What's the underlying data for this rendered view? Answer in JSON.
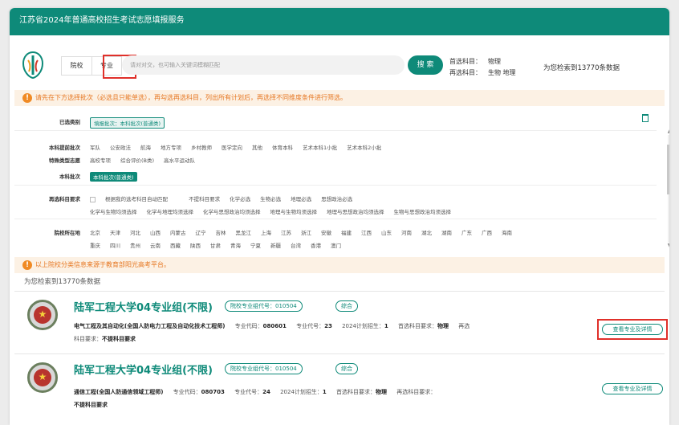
{
  "header": {
    "title": "江苏省2024年普通高校招生考试志愿填报服务"
  },
  "search": {
    "tab_school": "院校",
    "tab_major": "专业",
    "placeholder": "请对对交，也可输入关键词模糊匹配",
    "button": "搜 索",
    "first_subject_label": "首选科目：",
    "first_subject_value": "物理",
    "second_subject_label": "再选科目：",
    "second_subject_values": "生物 地理",
    "result_count": "为您检索到13770条数据"
  },
  "notice1": "请先在下方选择批次（必选且只能单选），再勾选再选科目，列出所有计划后，再选择不同维度条件进行筛选。",
  "notice2": "以上院校分类信息来源于教育部阳光高考平台。",
  "filters": {
    "selected_label": "已选类别",
    "selected_tag": "填报批次：本科批次(普通类)",
    "early_label": "本科提前批次",
    "early_options": [
      "军队",
      "公安政法",
      "航海",
      "地方专项",
      "乡村教师",
      "医学定向",
      "其他",
      "体育本科",
      "艺术本科1小批",
      "艺术本科2小批"
    ],
    "special_label": "特殊类型志愿",
    "special_options": [
      "高校专项",
      "综合评价(B类)",
      "高水平运动队"
    ],
    "batch_label": "本科批次",
    "batch_value": "本科批次(普通类)",
    "resubject_label": "再选科目要求",
    "resubject_check": "根据我的选考科目自动匹配",
    "resubject_row1": [
      "不提科目要求",
      "化学必选",
      "生物必选",
      "地理必选",
      "思想政治必选"
    ],
    "resubject_row2": [
      "化学与生物均须选择",
      "化学与地理均须选择",
      "化学与思想政治均须选择",
      "地理与生物均须选择",
      "地理与思想政治均须选择",
      "生物与思想政治均须选择"
    ],
    "region_label": "院校所在地",
    "region_row1": [
      "北京",
      "天津",
      "河北",
      "山西",
      "内蒙古",
      "辽宁",
      "吉林",
      "黑龙江",
      "上海",
      "江苏",
      "浙江",
      "安徽",
      "福建",
      "江西",
      "山东",
      "河南",
      "湖北",
      "湖南",
      "广东",
      "广西",
      "海南"
    ],
    "region_row2": [
      "重庆",
      "四川",
      "贵州",
      "云南",
      "西藏",
      "陕西",
      "甘肃",
      "青海",
      "宁夏",
      "新疆",
      "台湾",
      "香港",
      "澳门"
    ]
  },
  "results_count": "为您检索到13770条数据",
  "cards": [
    {
      "name": "陆军工程大学04专业组(不限)",
      "group_code": "院校专业组代号：010504",
      "tag": "综合",
      "major": "电气工程及其自动化(全国人防电力工程及自动化技术工程师)",
      "major_code_label": "专业代码：",
      "major_code": "080601",
      "major_no_label": "专业代号：",
      "major_no": "23",
      "plan_label": "2024计划招生：",
      "plan": "1",
      "first_req_label": "首选科目要求：",
      "first_req": "物理",
      "extra": "再选",
      "second_req_label": "科目要求：",
      "second_req": "不提科目要求",
      "detail_button": "查看专业及详情"
    },
    {
      "name": "陆军工程大学04专业组(不限)",
      "group_code": "院校专业组代号：010504",
      "tag": "综合",
      "major": "通信工程(全国人防通信领域工程师)",
      "major_code_label": "专业代码：",
      "major_code": "080703",
      "major_no_label": "专业代号：",
      "major_no": "24",
      "plan_label": "2024计划招生：",
      "plan": "1",
      "first_req_label": "首选科目要求：",
      "first_req": "物理",
      "second_req_label": "再选科目要求：",
      "second_req": "不提科目要求",
      "detail_button": "查看专业及详情"
    }
  ],
  "colors": {
    "brand": "#0e8a79",
    "warning": "#e67722",
    "highlight": "#e0302a"
  }
}
